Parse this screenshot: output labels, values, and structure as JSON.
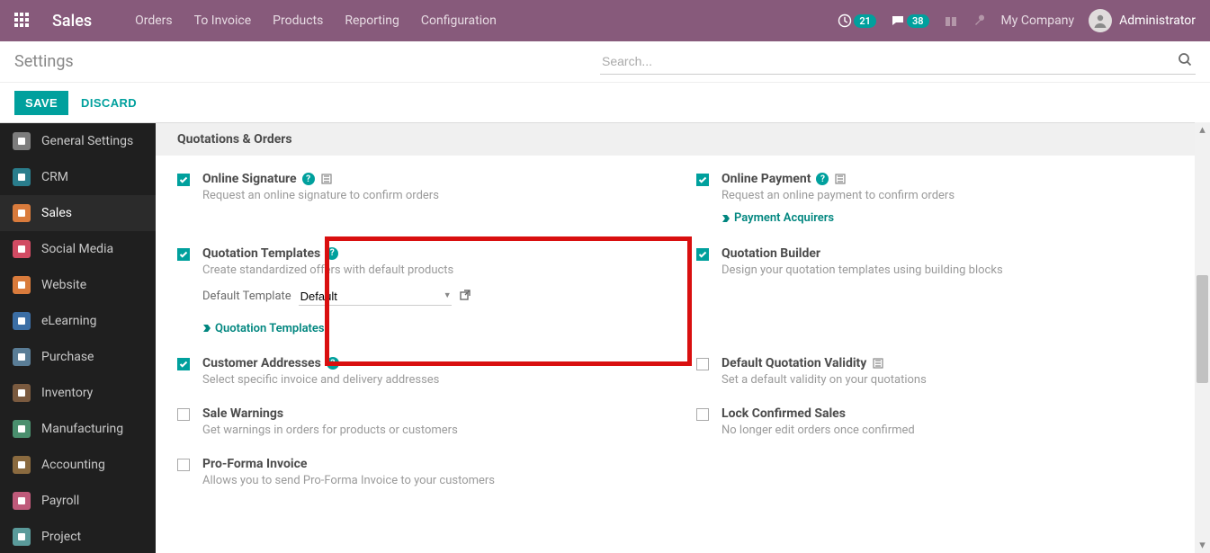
{
  "nav": {
    "brand": "Sales",
    "links": [
      "Orders",
      "To Invoice",
      "Products",
      "Reporting",
      "Configuration"
    ],
    "activity_count": "21",
    "discuss_count": "38",
    "company": "My Company",
    "user": "Administrator"
  },
  "control": {
    "title": "Settings",
    "search_placeholder": "Search..."
  },
  "actions": {
    "save": "SAVE",
    "discard": "DISCARD"
  },
  "sidebar": {
    "items": [
      {
        "label": "General Settings",
        "icon_bg": "#7d7d7d"
      },
      {
        "label": "CRM",
        "icon_bg": "#2a7d8c"
      },
      {
        "label": "Sales",
        "icon_bg": "#d97b3c",
        "active": true
      },
      {
        "label": "Social Media",
        "icon_bg": "#d14b63"
      },
      {
        "label": "Website",
        "icon_bg": "#d97b3c"
      },
      {
        "label": "eLearning",
        "icon_bg": "#3b6ea5"
      },
      {
        "label": "Purchase",
        "icon_bg": "#5a7d96"
      },
      {
        "label": "Inventory",
        "icon_bg": "#7a5a3f"
      },
      {
        "label": "Manufacturing",
        "icon_bg": "#4a8f6e"
      },
      {
        "label": "Accounting",
        "icon_bg": "#8a6a3f"
      },
      {
        "label": "Payroll",
        "icon_bg": "#bf5a7a"
      },
      {
        "label": "Project",
        "icon_bg": "#5a9a9a"
      }
    ]
  },
  "section_title": "Quotations & Orders",
  "settings": {
    "online_signature": {
      "title": "Online Signature",
      "desc": "Request an online signature to confirm orders",
      "checked": true
    },
    "online_payment": {
      "title": "Online Payment",
      "desc": "Request an online payment to confirm orders",
      "checked": true,
      "link": "Payment Acquirers"
    },
    "quotation_templates": {
      "title": "Quotation Templates",
      "desc": "Create standardized offers with default products",
      "checked": true,
      "template_label": "Default Template",
      "template_value": "Default",
      "link": "Quotation Templates"
    },
    "quotation_builder": {
      "title": "Quotation Builder",
      "desc": "Design your quotation templates using building blocks",
      "checked": true
    },
    "customer_addresses": {
      "title": "Customer Addresses",
      "desc": "Select specific invoice and delivery addresses",
      "checked": true
    },
    "default_validity": {
      "title": "Default Quotation Validity",
      "desc": "Set a default validity on your quotations",
      "checked": false
    },
    "sale_warnings": {
      "title": "Sale Warnings",
      "desc": "Get warnings in orders for products or customers",
      "checked": false
    },
    "lock_confirmed": {
      "title": "Lock Confirmed Sales",
      "desc": "No longer edit orders once confirmed",
      "checked": false
    },
    "proforma": {
      "title": "Pro-Forma Invoice",
      "desc": "Allows you to send Pro-Forma Invoice to your customers",
      "checked": false
    }
  }
}
